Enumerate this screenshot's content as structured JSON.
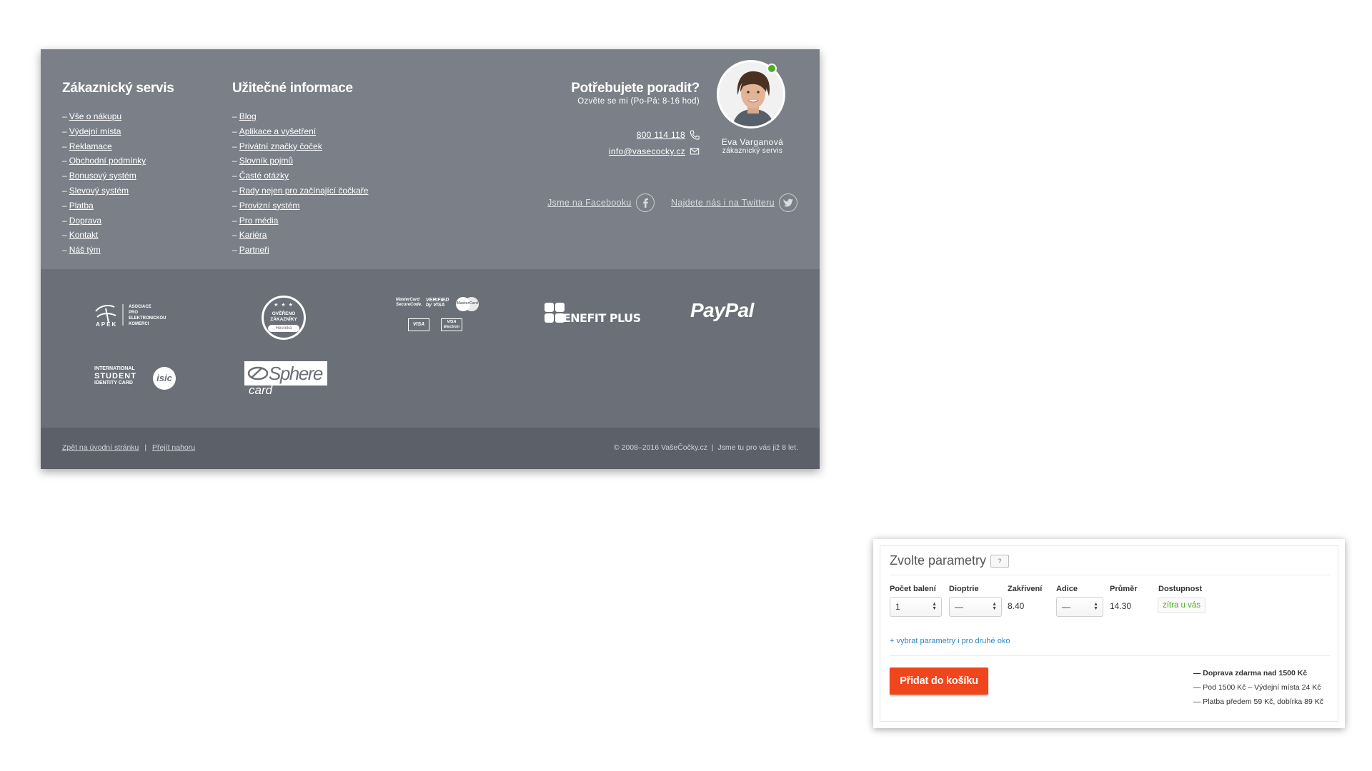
{
  "footer": {
    "customer_service": {
      "title": "Zákaznický servis",
      "links": [
        "Vše o nákupu",
        "Výdejní místa",
        "Reklamace",
        "Obchodní podmínky",
        "Bonusový systém",
        "Slevový systém",
        "Platba",
        "Doprava",
        "Kontakt",
        "Náš tým"
      ]
    },
    "useful_info": {
      "title": "Užitečné informace",
      "links": [
        "Blog",
        "Aplikace a vyšetření",
        "Privátní značky čoček",
        "Slovník pojmů",
        "Časté otázky",
        "Rady nejen pro začínající čočkaře",
        "Provizní systém",
        "Pro média",
        "Kariéra",
        "Partneři"
      ]
    },
    "help": {
      "title": "Potřebujete poradit?",
      "hours": "Ozvěte se mi (Po-Pá: 8-16 hod)",
      "phone": "800 114 118",
      "email": "info@vasecocky.cz",
      "agent_name": "Eva Varganová",
      "agent_role": "zákaznický servis"
    },
    "social": {
      "facebook": "Jsme na Facebooku",
      "twitter": "Najdete nás i na Twitteru"
    },
    "logos": {
      "apek": {
        "word": "APEK",
        "lines": [
          "ASOCIACE",
          "PRO",
          "ELEKTRONICKOU",
          "KOMERCI"
        ]
      },
      "heureka": {
        "lines": [
          "OVĚŘENO",
          "ZÁKAZNÍKY"
        ],
        "brand": "Heureka"
      },
      "cards": {
        "mc_secure": "MasterCard SecureCode.",
        "verified": "VERIFIED by VISA",
        "mastercard": "MasterCard",
        "visa": "VISA",
        "visa_electron": "VISA Electron"
      },
      "benefit": "BENEFIT PLUS",
      "paypal": "PayPal",
      "isic": {
        "lines": [
          "INTERNATIONAL",
          "STUDENT",
          "IDENTITY CARD"
        ],
        "badge": "isic"
      },
      "sphere": {
        "main": "Sphere",
        "sub": "card"
      }
    },
    "bottom": {
      "back_home": "Zpět na úvodní stránku",
      "separator": "|",
      "to_top": "Přejít nahoru",
      "copyright": "© 2008–2016 VašeČočky.cz  |  Jsme tu pro vás již 8 let."
    }
  },
  "params": {
    "title": "Zvolte parametry",
    "help_badge": "?",
    "headers": [
      "Počet balení",
      "Dioptrie",
      "Zakřivení",
      "Adice",
      "Průměr",
      "Dostupnost"
    ],
    "packages": "1",
    "diopters": "—",
    "curvature": "8.40",
    "addition": "—",
    "diameter": "14.30",
    "availability": "zítra u vás",
    "second_eye_link": "+ vybrat parametry i pro druhé oko",
    "add_to_cart": "Přidat do košíku",
    "shipping": [
      "— Doprava zdarma nad 1500 Kč",
      "— Pod 1500 Kč – Výdejní místa 24 Kč",
      "— Platba předem 59 Kč, dobírka 89 Kč"
    ],
    "colors": {
      "cta": "#f0461e",
      "availability": "#4caf22",
      "link": "#2a86c8"
    }
  }
}
